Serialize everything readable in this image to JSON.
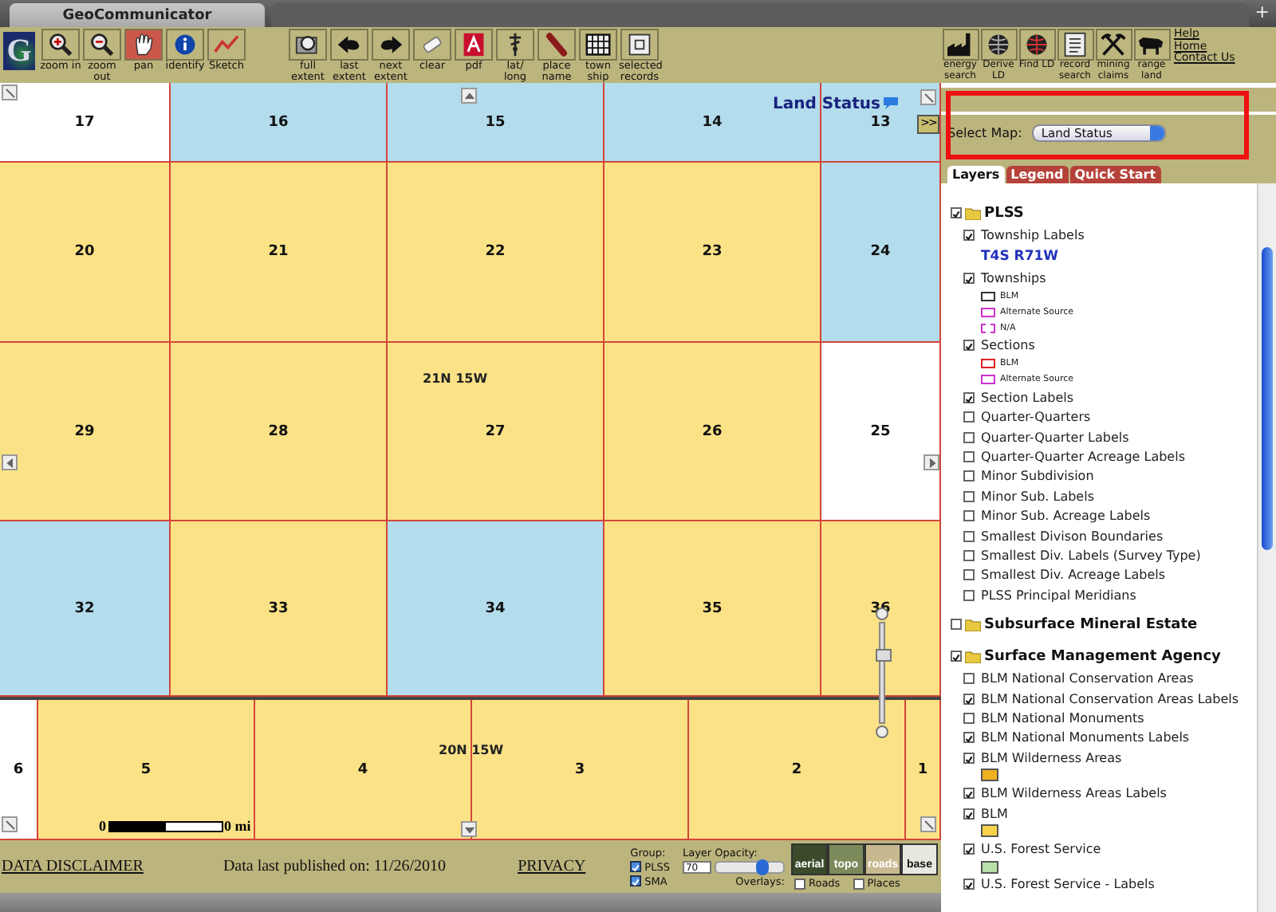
{
  "browser_tab": {
    "title": "GeoCommunicator",
    "new_tab": "+"
  },
  "toolbar": {
    "logo": "G",
    "tools": [
      {
        "kind": "zoomin",
        "label": "zoom in",
        "selected": false
      },
      {
        "kind": "zoomout",
        "label": "zoom out",
        "selected": false
      },
      {
        "kind": "pan",
        "label": "pan",
        "selected": true
      },
      {
        "kind": "identify",
        "label": "identify",
        "selected": false
      },
      {
        "kind": "sketch",
        "label": "Sketch",
        "selected": false
      }
    ],
    "extent_tools": [
      {
        "kind": "extent",
        "label": "full extent",
        "selected": false
      },
      {
        "kind": "back",
        "label": "last extent",
        "selected": false
      },
      {
        "kind": "forward",
        "label": "next extent",
        "selected": false
      },
      {
        "kind": "clear",
        "label": "clear",
        "selected": false
      },
      {
        "kind": "pdf",
        "label": "pdf",
        "selected": false
      },
      {
        "kind": "latlong",
        "label": "lat/ long",
        "selected": false
      },
      {
        "kind": "place",
        "label": "place name",
        "selected": false
      },
      {
        "kind": "township",
        "label": "town ship",
        "selected": false
      },
      {
        "kind": "records",
        "label": "selected records",
        "selected": false
      }
    ]
  },
  "map": {
    "title": "Land Status",
    "collapse_button": ">>",
    "sections": [
      [
        {
          "label": "17",
          "color": "#ffffff"
        },
        {
          "label": "16",
          "color": "#b3dcec"
        },
        {
          "label": "15",
          "color": "#b3dcec"
        },
        {
          "label": "14",
          "color": "#b3dcec"
        },
        {
          "label": "13",
          "color": "#b3dcec"
        }
      ],
      [
        {
          "label": "20",
          "color": "#fbe286"
        },
        {
          "label": "21",
          "color": "#fbe286"
        },
        {
          "label": "22",
          "color": "#fbe286"
        },
        {
          "label": "23",
          "color": "#fbe286"
        },
        {
          "label": "24",
          "color": "#b3dcec"
        }
      ],
      [
        {
          "label": "29",
          "color": "#fbe286"
        },
        {
          "label": "28",
          "color": "#fbe286"
        },
        {
          "label": "27",
          "color": "#fbe286"
        },
        {
          "label": "26",
          "color": "#fbe286"
        },
        {
          "label": "25",
          "color": "#ffffff"
        }
      ],
      [
        {
          "label": "32",
          "color": "#b3dcec"
        },
        {
          "label": "33",
          "color": "#fbe286"
        },
        {
          "label": "34",
          "color": "#b3dcec"
        },
        {
          "label": "35",
          "color": "#fbe286"
        },
        {
          "label": "36",
          "color": "#fbe286"
        }
      ],
      [
        {
          "label": "6",
          "color": "#ffffff"
        },
        {
          "label": "5",
          "color": "#fbe286"
        },
        {
          "label": "4",
          "color": "#fbe286"
        },
        {
          "label": "3",
          "color": "#fbe286"
        },
        {
          "label": "2",
          "color": "#fbe286"
        },
        {
          "label": "1",
          "color": "#fbe286"
        }
      ]
    ],
    "townships": [
      "21N 15W",
      "20N 15W"
    ],
    "scale_bar": {
      "start": "0",
      "end": "0 mi"
    },
    "zoom": {
      "level": 0.7
    }
  },
  "footer": {
    "disclaimer": "DATA DISCLAIMER",
    "published": "Data last published on: 11/26/2010",
    "privacy": "PRIVACY",
    "group_label": "Group:",
    "groups": [
      {
        "label": "PLSS",
        "checked": true
      },
      {
        "label": "SMA",
        "checked": true
      }
    ],
    "opacity_label": "Layer Opacity:",
    "opacity_value": "70",
    "opacity": {
      "level": 0.7
    },
    "overlays_label": "Overlays:",
    "overlays": [
      {
        "label": "Roads",
        "checked": false
      },
      {
        "label": "Places",
        "checked": false
      }
    ],
    "basemaps": [
      "aerial",
      "topo",
      "roads",
      "base"
    ]
  },
  "panel": {
    "tools": [
      {
        "kind": "energy",
        "label": "energy search"
      },
      {
        "kind": "derive",
        "label": "Derive LD"
      },
      {
        "kind": "find",
        "label": "Find LD"
      },
      {
        "kind": "record",
        "label": "record search"
      },
      {
        "kind": "mining",
        "label": "mining claims"
      },
      {
        "kind": "range",
        "label": "range land"
      }
    ],
    "links": [
      "Help",
      "Home",
      "Contact Us"
    ],
    "select_label": "Select Map:",
    "select_value": "Land Status",
    "tabs": [
      {
        "label": "Layers",
        "selected": true
      },
      {
        "label": "Legend",
        "selected": false
      },
      {
        "label": "Quick Start",
        "selected": false
      }
    ],
    "layer_groups": [
      {
        "label": "PLSS",
        "checked": true,
        "children": [
          {
            "kind": "layer",
            "label": "Township Labels",
            "checked": true
          },
          {
            "kind": "sample",
            "label": "T4S R71W"
          },
          {
            "kind": "layer",
            "label": "Townships",
            "checked": true,
            "legend": [
              {
                "kind": "outline",
                "color": "#333333",
                "label": "BLM"
              },
              {
                "kind": "outline",
                "color": "#cc33cc",
                "label": "Alternate Source"
              },
              {
                "kind": "dashed",
                "color": "#cc33cc",
                "label": "N/A"
              }
            ]
          },
          {
            "kind": "layer",
            "label": "Sections",
            "checked": true,
            "legend": [
              {
                "kind": "outline",
                "color": "#dd2222",
                "label": "BLM"
              },
              {
                "kind": "outline",
                "color": "#cc33cc",
                "label": "Alternate Source"
              }
            ]
          },
          {
            "kind": "layer",
            "label": "Section Labels",
            "checked": true
          },
          {
            "kind": "layer",
            "label": "Quarter-Quarters",
            "checked": false
          },
          {
            "kind": "layer",
            "label": "Quarter-Quarter Labels",
            "checked": false
          },
          {
            "kind": "layer",
            "label": "Quarter-Quarter Acreage Labels",
            "checked": false
          },
          {
            "kind": "layer",
            "label": "Minor Subdivision",
            "checked": false
          },
          {
            "kind": "layer",
            "label": "Minor Sub. Labels",
            "checked": false
          },
          {
            "kind": "layer",
            "label": "Minor Sub. Acreage Labels",
            "checked": false
          },
          {
            "kind": "layer",
            "label": "Smallest Divison Boundaries",
            "checked": false
          },
          {
            "kind": "layer",
            "label": "Smallest Div. Labels (Survey Type)",
            "checked": false
          },
          {
            "kind": "layer",
            "label": "Smallest Div. Acreage Labels",
            "checked": false
          },
          {
            "kind": "layer",
            "label": "PLSS Principal Meridians",
            "checked": false
          }
        ]
      },
      {
        "label": "Subsurface Mineral Estate",
        "checked": false
      },
      {
        "label": "Surface Management Agency",
        "checked": true,
        "children": [
          {
            "kind": "layer",
            "label": "BLM National Conservation Areas",
            "checked": false
          },
          {
            "kind": "layer",
            "label": "BLM National Conservation Areas Labels",
            "checked": true
          },
          {
            "kind": "layer",
            "label": "BLM National Monuments",
            "checked": false
          },
          {
            "kind": "layer",
            "label": "BLM National Monuments Labels",
            "checked": true
          },
          {
            "kind": "layer",
            "label": "BLM Wilderness Areas",
            "checked": true,
            "legend": [
              {
                "kind": "fill",
                "color": "#f0b020"
              }
            ]
          },
          {
            "kind": "layer",
            "label": "BLM Wilderness Areas Labels",
            "checked": true
          },
          {
            "kind": "layer",
            "label": "BLM",
            "checked": true,
            "legend": [
              {
                "kind": "fill",
                "color": "#fad24a"
              }
            ]
          },
          {
            "kind": "layer",
            "label": "U.S. Forest Service",
            "checked": true,
            "legend": [
              {
                "kind": "fill",
                "color": "#b8e0a8"
              }
            ]
          },
          {
            "kind": "layer",
            "label": "U.S. Forest Service - Labels",
            "checked": true
          }
        ]
      }
    ]
  }
}
